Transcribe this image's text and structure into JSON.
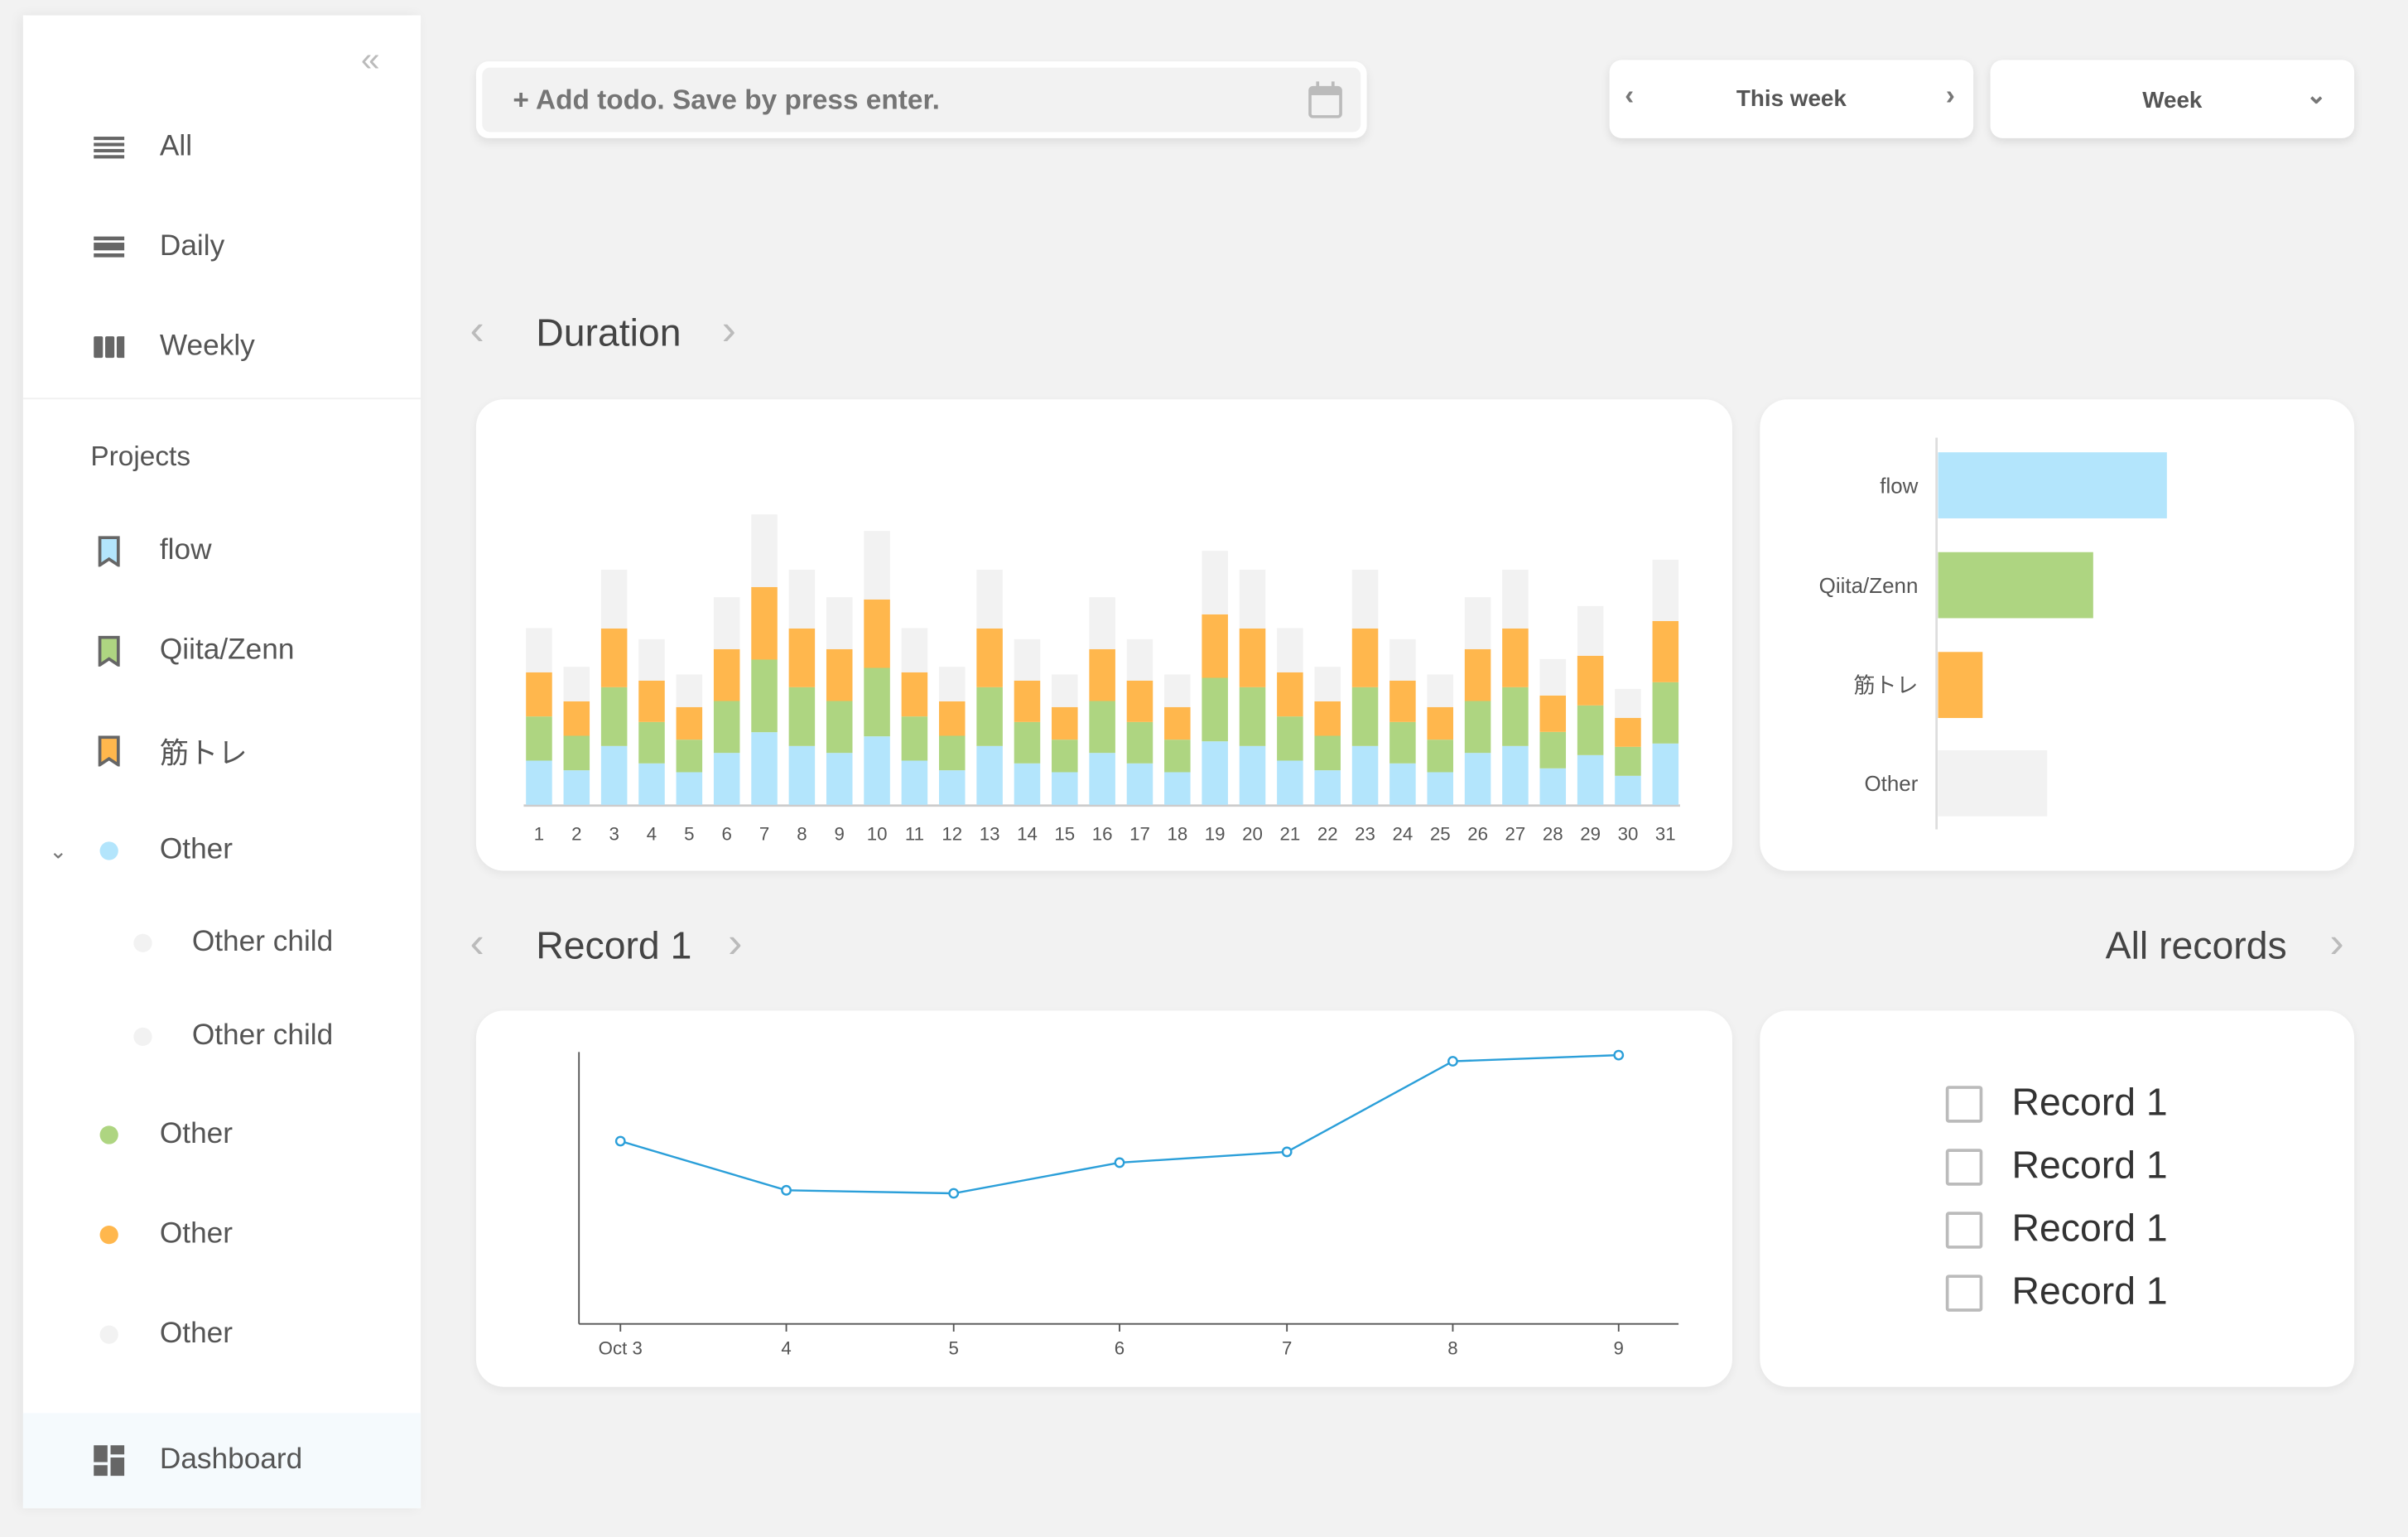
{
  "sidebar": {
    "collapse_icon": "double-chevron-left",
    "views": [
      {
        "label": "All",
        "icon": "list-icon"
      },
      {
        "label": "Daily",
        "icon": "daily-icon"
      },
      {
        "label": "Weekly",
        "icon": "columns-icon"
      }
    ],
    "projects_heading": "Projects",
    "projects": [
      {
        "label": "flow",
        "icon": "bookmark",
        "color": "#b3e5fc"
      },
      {
        "label": "Qiita/Zenn",
        "icon": "bookmark",
        "color": "#aed581"
      },
      {
        "label": "筋トレ",
        "icon": "bookmark",
        "color": "#ffb74d"
      }
    ],
    "others": [
      {
        "label": "Other",
        "color": "#b3e5fc",
        "expanded": true,
        "children": [
          {
            "label": "Other child",
            "color": "#f2f2f2"
          },
          {
            "label": "Other child",
            "color": "#f2f2f2"
          }
        ]
      },
      {
        "label": "Other",
        "color": "#aed581"
      },
      {
        "label": "Other",
        "color": "#ffb74d"
      },
      {
        "label": "Other",
        "color": "#f2f2f2"
      }
    ],
    "dashboard": {
      "label": "Dashboard",
      "icon": "dashboard-icon",
      "active": true
    }
  },
  "toolbar": {
    "todo_placeholder": "+ Add todo. Save by press enter.",
    "period_label": "This week",
    "range_select": "Week"
  },
  "duration": {
    "title": "Duration"
  },
  "record": {
    "title": "Record 1",
    "all_records": "All records",
    "list": [
      "Record 1",
      "Record 1",
      "Record 1",
      "Record 1"
    ]
  },
  "colors": {
    "flow": "#b3e5fc",
    "qiita": "#aed581",
    "kintore": "#ffb74d",
    "other": "#f2f2f2",
    "line": "#2b9fd9"
  },
  "chart_data": [
    {
      "type": "bar",
      "stacked": true,
      "categories": [
        "1",
        "2",
        "3",
        "4",
        "5",
        "6",
        "7",
        "8",
        "9",
        "10",
        "11",
        "12",
        "13",
        "14",
        "15",
        "16",
        "17",
        "18",
        "19",
        "20",
        "21",
        "22",
        "23",
        "24",
        "25",
        "26",
        "27",
        "28",
        "29",
        "30",
        "31"
      ],
      "series": [
        {
          "name": "flow",
          "color": "#b3e5fc",
          "values": [
            16,
            12.5,
            21.3,
            15,
            11.8,
            18.8,
            26.3,
            21.3,
            18.8,
            24.8,
            16,
            12.5,
            21.3,
            15,
            11.8,
            18.8,
            15,
            11.8,
            23,
            21.3,
            16,
            12.5,
            21.3,
            15,
            11.8,
            18.8,
            21.3,
            13.2,
            18,
            10.5,
            22.2
          ]
        },
        {
          "name": "Qiita/Zenn",
          "color": "#aed581",
          "values": [
            16,
            12.5,
            21.3,
            15,
            11.8,
            18.8,
            26.3,
            21.3,
            18.8,
            24.8,
            16,
            12.5,
            21.3,
            15,
            11.8,
            18.8,
            15,
            11.8,
            23,
            21.3,
            16,
            12.5,
            21.3,
            15,
            11.8,
            18.8,
            21.3,
            13.2,
            18,
            10.5,
            22.2
          ]
        },
        {
          "name": "筋トレ",
          "color": "#ffb74d",
          "values": [
            16,
            12.5,
            21.3,
            15,
            11.8,
            18.8,
            26.3,
            21.3,
            18.8,
            24.8,
            16,
            12.5,
            21.3,
            15,
            11.8,
            18.8,
            15,
            11.8,
            23,
            21.3,
            16,
            12.5,
            21.3,
            15,
            11.8,
            18.8,
            21.3,
            13.2,
            18,
            10.5,
            22.2
          ]
        },
        {
          "name": "Other",
          "color": "#f2f2f2",
          "values": [
            16,
            12.5,
            21.3,
            15,
            11.8,
            18.8,
            26.3,
            21.3,
            18.8,
            24.8,
            16,
            12.5,
            21.3,
            15,
            11.8,
            18.8,
            15,
            11.8,
            23,
            21.3,
            16,
            12.5,
            21.3,
            15,
            11.8,
            18.8,
            21.3,
            13.2,
            18,
            10.5,
            22.2
          ]
        }
      ],
      "grid": false
    },
    {
      "type": "bar",
      "orientation": "horizontal",
      "categories": [
        "flow",
        "Qiita/Zenn",
        "筋トレ",
        "Other"
      ],
      "values": [
        149,
        101,
        29,
        71
      ],
      "colors": [
        "#b3e5fc",
        "#aed581",
        "#ffb74d",
        "#f2f2f2"
      ]
    },
    {
      "type": "line",
      "x": [
        "Oct 3",
        "4",
        "5",
        "6",
        "7",
        "8",
        "9"
      ],
      "values": [
        119,
        87,
        85,
        105,
        112,
        171,
        175
      ],
      "ylim": [
        0,
        177
      ],
      "grid": false
    }
  ]
}
